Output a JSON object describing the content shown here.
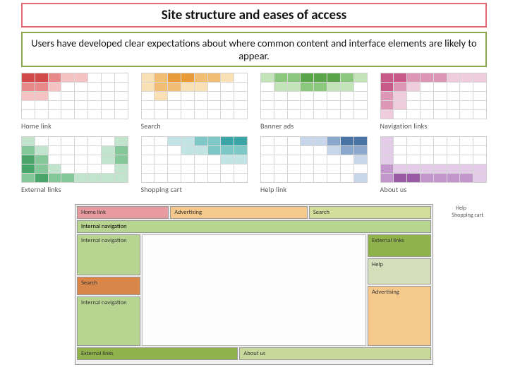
{
  "title": "Site structure and eases of access",
  "subtitle": "Users have developed clear expectations about where common content and interface elements are likely to appear.",
  "heatmaps": {
    "row1": [
      {
        "label": "Home link"
      },
      {
        "label": "Search"
      },
      {
        "label": "Banner ads"
      },
      {
        "label": "Navigation links"
      }
    ],
    "row2": [
      {
        "label": "External links"
      },
      {
        "label": "Shopping cart"
      },
      {
        "label": "Help link"
      },
      {
        "label": "About us"
      }
    ]
  },
  "wireframe": {
    "top": {
      "home": "Home link",
      "advertising": "Advertising",
      "search": "Search"
    },
    "internal_nav": "Internal navigation",
    "left": {
      "nav1": "Internal navigation",
      "search": "Search",
      "nav2": "Internal navigation"
    },
    "right": {
      "external": "External links",
      "help": "Help",
      "advertising": "Advertising"
    },
    "bottom": {
      "external": "External links",
      "about": "About us"
    },
    "annotations": {
      "help": "Help",
      "cart": "Shopping cart"
    }
  }
}
